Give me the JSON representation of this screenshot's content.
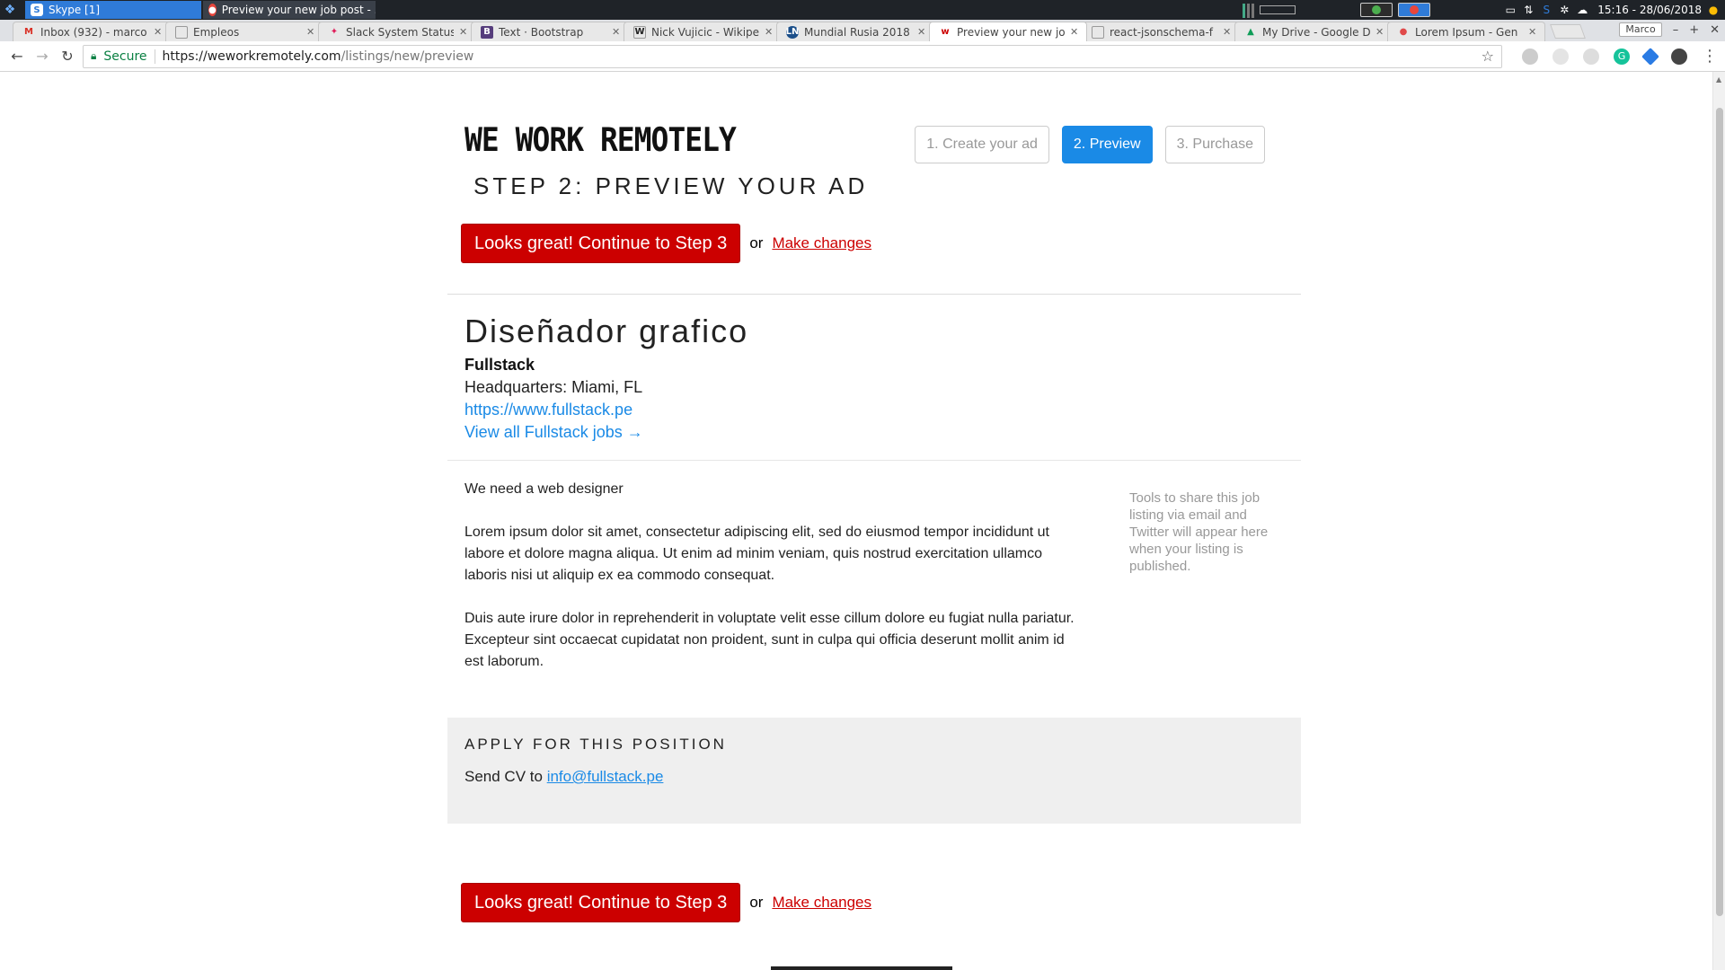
{
  "taskbar": {
    "tasks": [
      {
        "label": "Skype [1]",
        "icon": "skype-icon"
      },
      {
        "label": "Preview your new job post - ...",
        "icon": "chrome-icon"
      }
    ],
    "clock": "15:16 - 28/06/2018"
  },
  "browser": {
    "tabs": [
      {
        "label": "Inbox (932) - marco",
        "icon": "gmail-icon"
      },
      {
        "label": "Empleos",
        "icon": "document-icon"
      },
      {
        "label": "Slack System Status",
        "icon": "slack-icon"
      },
      {
        "label": "Text · Bootstrap",
        "icon": "bootstrap-icon"
      },
      {
        "label": "Nick Vujicic - Wikipe",
        "icon": "wikipedia-icon"
      },
      {
        "label": "Mundial Rusia 2018",
        "icon": "ln-icon"
      },
      {
        "label": "Preview your new jo",
        "icon": "wwr-icon",
        "active": true
      },
      {
        "label": "react-jsonschema-f",
        "icon": "document-icon"
      },
      {
        "label": "My Drive - Google D",
        "icon": "drive-icon"
      },
      {
        "label": "Lorem Ipsum - Gen",
        "icon": "lorem-icon"
      }
    ],
    "profile": "Marco",
    "omnibox": {
      "secure_label": "Secure",
      "url_prefix": "https://",
      "url_host": "weworkremotely.com",
      "url_path": "/listings/new/preview"
    }
  },
  "page": {
    "logo": "WE WORK REMOTELY",
    "steps": [
      {
        "label": "1. Create your ad",
        "active": false
      },
      {
        "label": "2. Preview",
        "active": true
      },
      {
        "label": "3. Purchase",
        "active": false
      }
    ],
    "step_title": "STEP 2: PREVIEW YOUR AD",
    "continue_label": "Looks great! Continue to Step 3",
    "or_text": "or",
    "make_changes": "Make changes",
    "job": {
      "title": "Diseñador grafico",
      "company": "Fullstack",
      "hq_label": "Headquarters:",
      "hq_value": "Miami, FL",
      "website": "https://www.fullstack.pe",
      "view_all": "View all Fullstack jobs →",
      "description": [
        "We need a web designer",
        "Lorem ipsum dolor sit amet, consectetur adipiscing elit, sed do eiusmod tempor incididunt ut labore et dolore magna aliqua. Ut enim ad minim veniam, quis nostrud exercitation ullamco laboris nisi ut aliquip ex ea commodo consequat.",
        "Duis aute irure dolor in reprehenderit in voluptate velit esse cillum dolore eu fugiat nulla pariatur. Excepteur sint occaecat cupidatat non proident, sunt in culpa qui officia deserunt mollit anim id est laborum."
      ],
      "share_note": "Tools to share this job listing via email and Twitter will appear here when your listing is published."
    },
    "apply": {
      "heading": "APPLY FOR THIS POSITION",
      "send_text": "Send CV to",
      "email": "info@fullstack.pe"
    }
  },
  "colors": {
    "accent_blue": "#1a8ae6",
    "brand_red": "#cc0000"
  }
}
